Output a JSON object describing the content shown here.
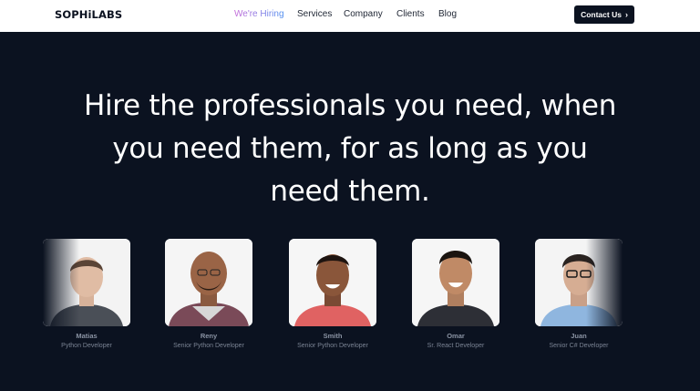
{
  "header": {
    "logo": "SOPHiLABS",
    "nav": [
      {
        "label": "We're Hiring",
        "active": true
      },
      {
        "label": "Services"
      },
      {
        "label": "Company"
      },
      {
        "label": "Clients"
      },
      {
        "label": "Blog"
      }
    ],
    "cta": {
      "label": "Contact Us",
      "icon": "chevron-right-icon"
    }
  },
  "hero": {
    "title_lines": [
      "Hire the professionals you need, when",
      "you need them, for as long as you",
      "need them."
    ]
  },
  "team": [
    {
      "name": "Matias",
      "role": "Python Developer"
    },
    {
      "name": "Reny",
      "role": "Senior Python Developer"
    },
    {
      "name": "Smith",
      "role": "Senior Python Developer"
    },
    {
      "name": "Omar",
      "role": "Sr. React Developer"
    },
    {
      "name": "Juan",
      "role": "Senior C# Developer"
    }
  ],
  "colors": {
    "background": "#0b1220",
    "header": "#ffffff",
    "accent_gradient_start": "#c66ad8",
    "accent_gradient_end": "#4b8ef0",
    "button": "#0b1220"
  }
}
